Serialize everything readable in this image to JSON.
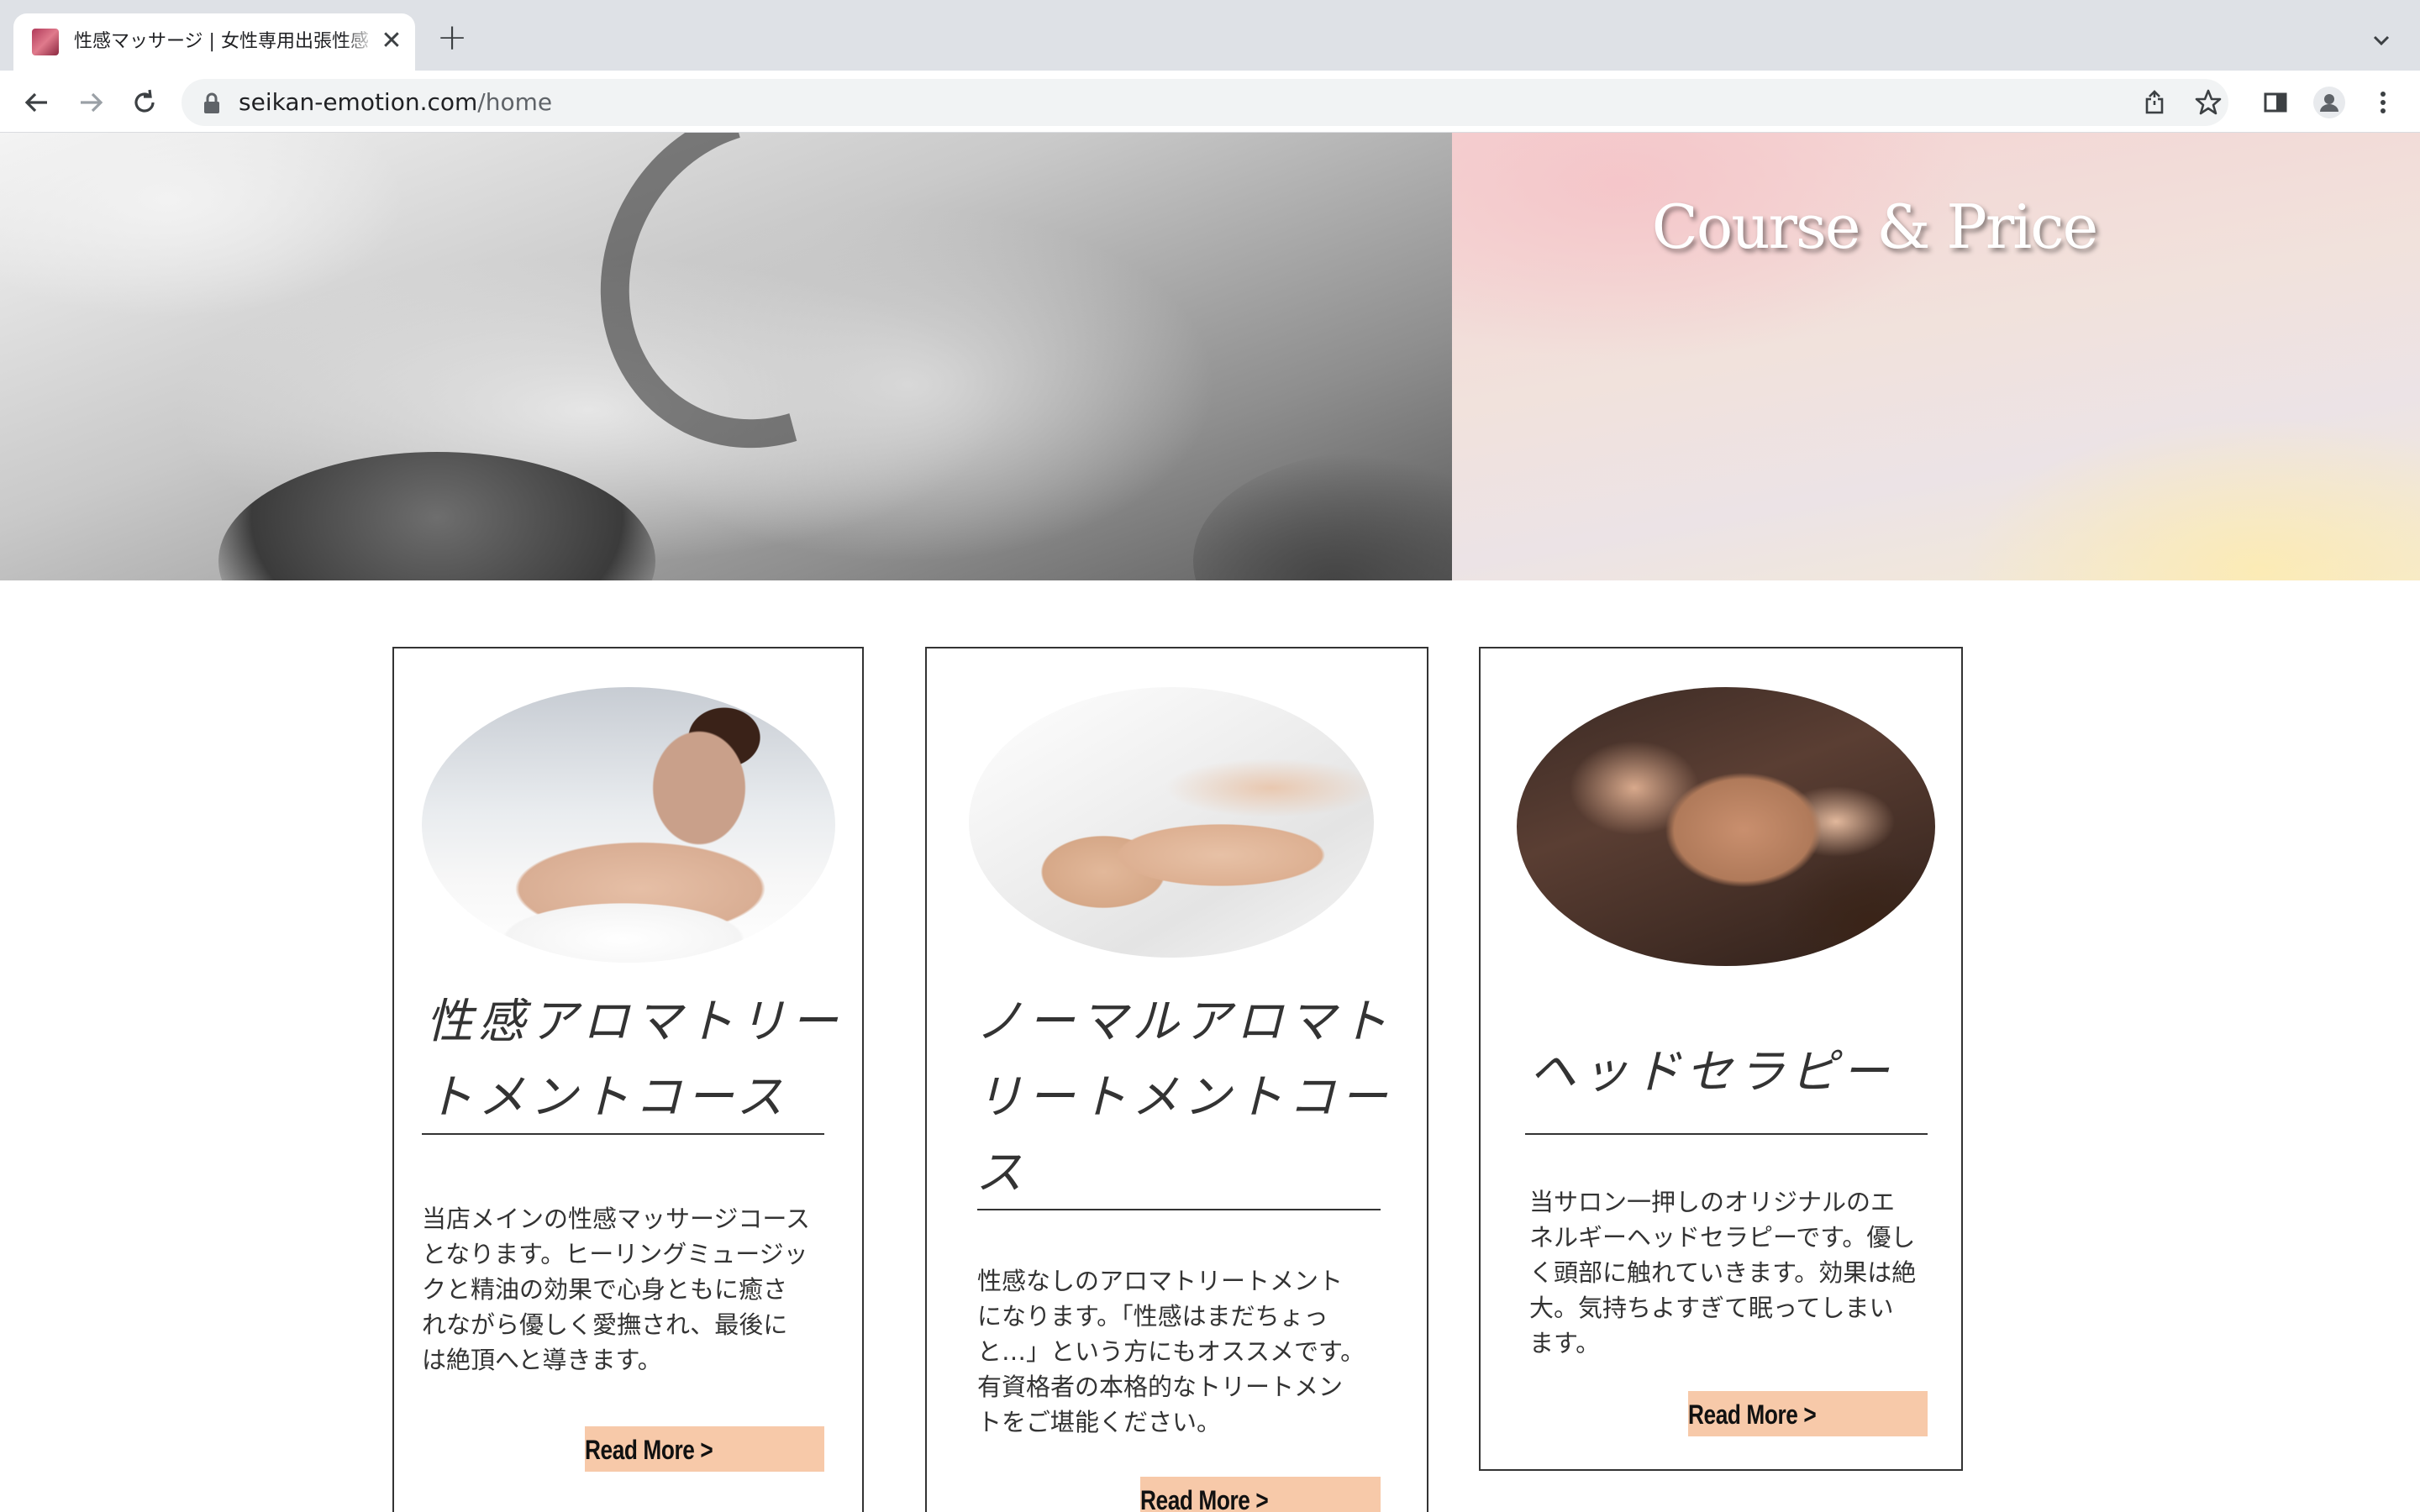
{
  "browser": {
    "tab_title": "性感マッサージ | 女性専用出張性感",
    "tab_close": "✕",
    "new_tab": "+",
    "url_domain": "seikan-emotion.com",
    "url_path": "/home"
  },
  "hero": {
    "title": "Course & Price"
  },
  "cards": [
    {
      "title_line1": "性感アロマトリー",
      "title_line2": "トメントコース",
      "title_line3": "",
      "text_lines": [
        "当店メインの性感マッサージコース",
        "となります。ヒーリングミュージッ",
        "クと精油の効果で心身ともに癒さ",
        "れながら優しく愛撫され、最後に",
        "は絶頂へと導きます。"
      ],
      "button": "Read More >"
    },
    {
      "title_line1": "ノーマルアロマト",
      "title_line2": "リートメントコー",
      "title_line3": "ス",
      "text_lines": [
        "性感なしのアロマトリートメント",
        "になります。「性感はまだちょっ",
        "と…」という方にもオススメです。",
        "有資格者の本格的なトリートメン",
        "トをご堪能ください。"
      ],
      "button": "Read More >"
    },
    {
      "title_line1": "ヘッドセラピー",
      "title_line2": "",
      "title_line3": "",
      "text_lines": [
        "当サロン一押しのオリジナルのエ",
        "ネルギーヘッドセラピーです。優し",
        "く頭部に触れていきます。効果は絶",
        "大。気持ちよすぎて眠ってしまい",
        "ます。"
      ],
      "button": "Read More >"
    }
  ],
  "colors": {
    "button_bg": "#f7c9a9",
    "card_border": "#333333",
    "text": "#333333"
  },
  "icons": {
    "back": "back-arrow-icon",
    "forward": "forward-arrow-icon",
    "reload": "reload-icon",
    "lock": "lock-icon",
    "share": "share-icon",
    "bookmark": "star-icon",
    "side_panel": "side-panel-icon",
    "profile": "profile-icon",
    "menu": "kebab-menu-icon",
    "tab_list": "chevron-down-icon"
  }
}
